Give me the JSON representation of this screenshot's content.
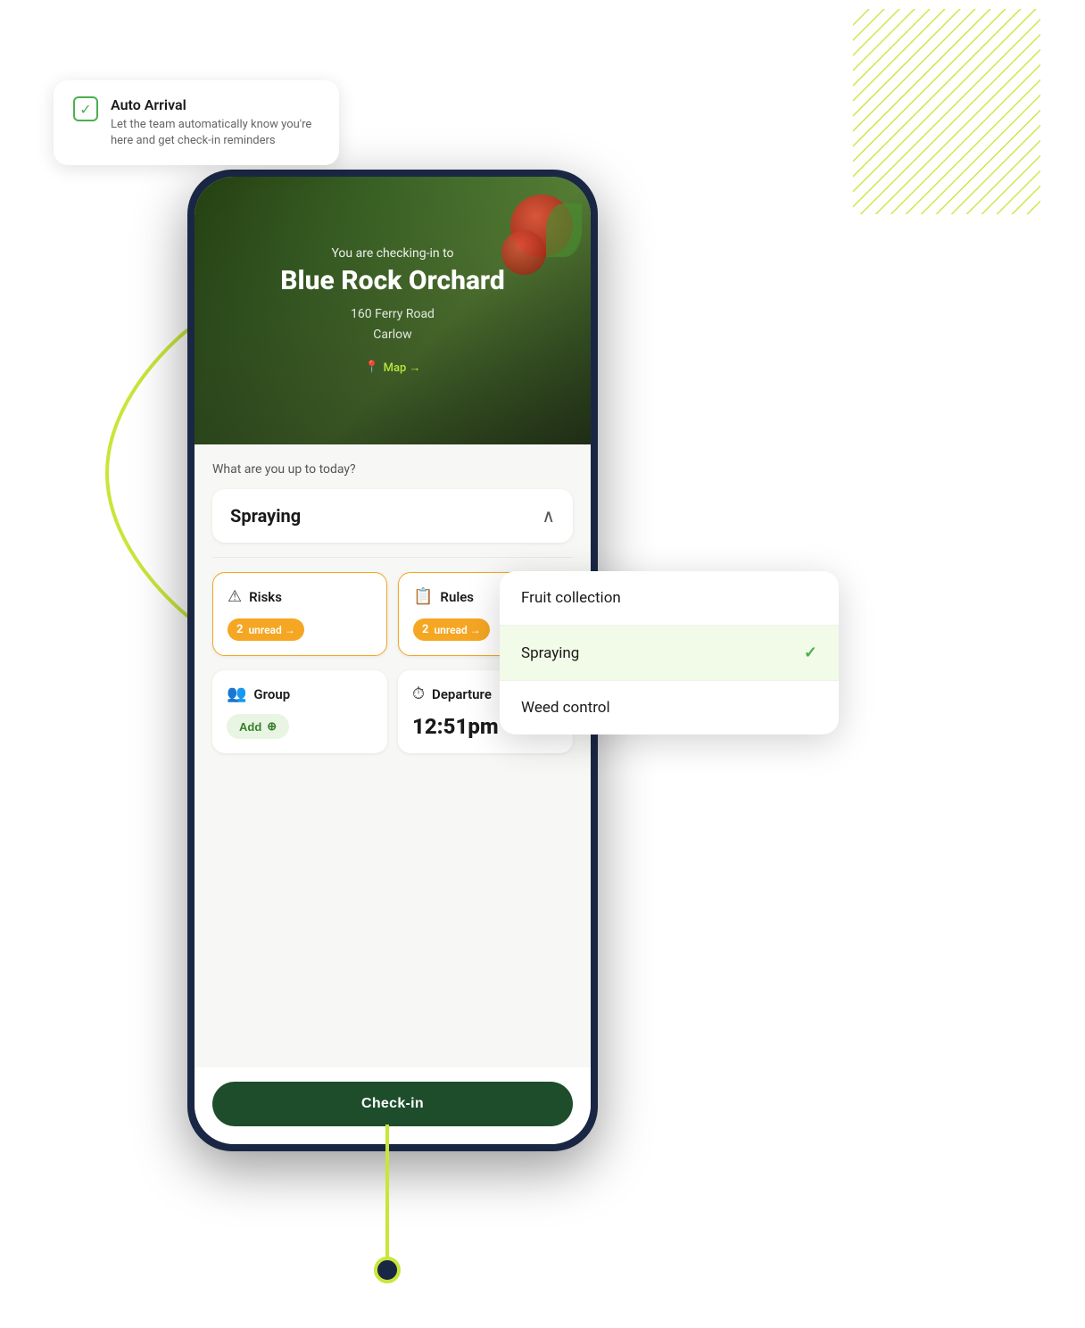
{
  "tooltip": {
    "title": "Auto Arrival",
    "description": "Let the team automatically know you're here and get check-in reminders"
  },
  "hero": {
    "subtitle": "You are checking-in to",
    "title": "Blue Rock Orchard",
    "address_line1": "160 Ferry Road",
    "address_line2": "Carlow",
    "map_link": "Map →"
  },
  "content": {
    "question": "What are you up to today?",
    "selected_activity": "Spraying"
  },
  "risks_card": {
    "title": "Risks",
    "badge_count": "2",
    "badge_text": "unread →"
  },
  "rules_card": {
    "title": "Rules",
    "badge_count": "2",
    "badge_text": "unread →"
  },
  "group_card": {
    "title": "Group",
    "add_button": "Add"
  },
  "departure_card": {
    "title": "Departure",
    "time": "12:51pm"
  },
  "checkin_button": {
    "label": "Check-in"
  },
  "dropdown": {
    "items": [
      {
        "label": "Fruit collection",
        "selected": false
      },
      {
        "label": "Spraying",
        "selected": true
      },
      {
        "label": "Weed control",
        "selected": false
      }
    ]
  }
}
